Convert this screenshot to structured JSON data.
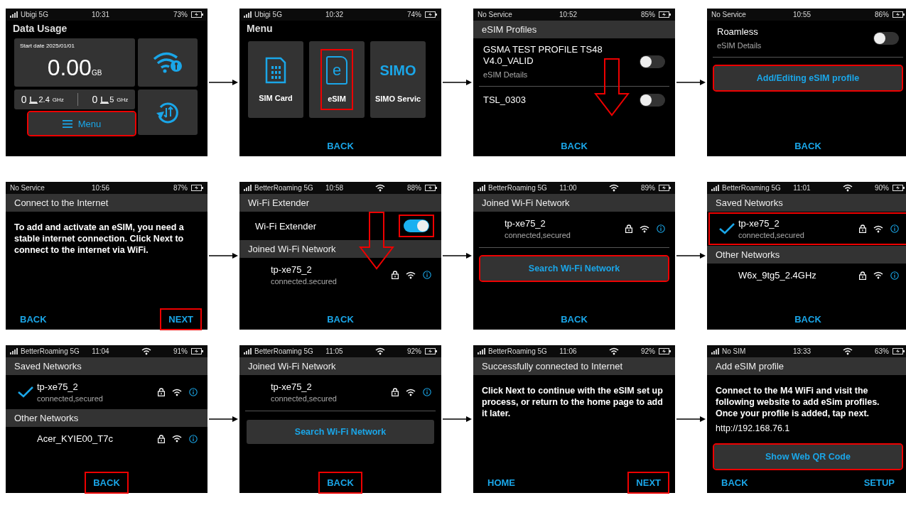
{
  "screens": [
    {
      "status": {
        "signal": true,
        "carrier": "Ubigi 5G",
        "time": "10:31",
        "wifi": false,
        "battery": "73%"
      },
      "scroll_hint": false,
      "blocks": [
        {
          "kind": "title",
          "text": "Data Usage"
        },
        {
          "kind": "dashboard",
          "start_date": "Start date 2025/01/01",
          "value": "0.00",
          "unit": "GB",
          "bands": [
            {
              "count": "0",
              "band": "2.4",
              "unit": "GHz"
            },
            {
              "count": "0",
              "band": "5",
              "unit": "GHz"
            }
          ],
          "menu": {
            "label": "Menu",
            "highlighted": true
          }
        }
      ]
    },
    {
      "status": {
        "signal": true,
        "carrier": "Ubigi 5G",
        "time": "10:32",
        "wifi": false,
        "battery": "74%"
      },
      "scroll_hint": false,
      "blocks": [
        {
          "kind": "title",
          "text": "Menu"
        },
        {
          "kind": "tiles",
          "tiles": [
            {
              "kind": "sim",
              "label": "SIM Card",
              "highlighted": false
            },
            {
              "kind": "esim",
              "glyph": "e",
              "label": "eSIM",
              "highlighted": true
            },
            {
              "kind": "logo",
              "glyph": "SIMO",
              "label": "SIMO Servic",
              "highlighted": false
            }
          ]
        }
      ],
      "footer": [
        {
          "label": "BACK",
          "highlighted": false
        }
      ]
    },
    {
      "status": {
        "signal": false,
        "carrier": "No Service",
        "time": "10:52",
        "wifi": false,
        "battery": "85%"
      },
      "scroll_hint": true,
      "blocks": [
        {
          "kind": "header",
          "text": "eSIM Profiles"
        },
        {
          "kind": "profile",
          "name": "GSMA TEST PROFILE TS48 V4.0_VALID",
          "detail": "eSIM Details",
          "on": false
        },
        {
          "kind": "divider"
        },
        {
          "kind": "profile",
          "name": "TSL_0303",
          "on": false
        }
      ],
      "footer": [
        {
          "label": "BACK",
          "highlighted": false
        }
      ]
    },
    {
      "status": {
        "signal": false,
        "carrier": "No Service",
        "time": "10:55",
        "wifi": false,
        "battery": "86%"
      },
      "scroll_hint": false,
      "blocks": [
        {
          "kind": "profile",
          "name": "Roamless",
          "detail": "eSIM Details",
          "on": false
        },
        {
          "kind": "divider"
        },
        {
          "kind": "button",
          "label": "Add/Editing eSIM profile",
          "highlighted": true
        }
      ],
      "footer": [
        {
          "label": "BACK",
          "highlighted": false
        }
      ]
    },
    {
      "status": {
        "signal": false,
        "carrier": "No Service",
        "time": "10:56",
        "wifi": false,
        "battery": "87%"
      },
      "scroll_hint": false,
      "blocks": [
        {
          "kind": "header",
          "text": "Connect to the Internet"
        },
        {
          "kind": "paragraph",
          "text": "To add and activate an eSIM, you need a stable internet connection. Click Next to connect to the internet via WiFi."
        }
      ],
      "footer": [
        {
          "label": "BACK",
          "highlighted": false
        },
        {
          "label": "NEXT",
          "highlighted": true
        }
      ]
    },
    {
      "status": {
        "signal": true,
        "carrier": "BetterRoaming 5G",
        "time": "10:58",
        "wifi": true,
        "battery": "88%"
      },
      "scroll_hint": true,
      "blocks": [
        {
          "kind": "header",
          "text": "Wi-Fi Extender"
        },
        {
          "kind": "toggle_row",
          "label": "Wi-Fi Extender",
          "on": true,
          "highlighted": true
        },
        {
          "kind": "header",
          "text": "Joined Wi-Fi Network"
        },
        {
          "kind": "network",
          "name": "tp-xe75_2",
          "state": "connected.secured",
          "checked": false,
          "highlighted": false
        }
      ],
      "footer": [
        {
          "label": "BACK",
          "highlighted": false
        }
      ]
    },
    {
      "status": {
        "signal": true,
        "carrier": "BetterRoaming 5G",
        "time": "11:00",
        "wifi": true,
        "battery": "89%"
      },
      "scroll_hint": false,
      "blocks": [
        {
          "kind": "header",
          "text": "Joined Wi-Fi Network"
        },
        {
          "kind": "network",
          "name": "tp-xe75_2",
          "state": "connected,secured",
          "checked": false,
          "highlighted": false
        },
        {
          "kind": "divider"
        },
        {
          "kind": "button",
          "label": "Search Wi-Fi Network",
          "highlighted": true
        }
      ],
      "footer": [
        {
          "label": "BACK",
          "highlighted": false
        }
      ]
    },
    {
      "status": {
        "signal": true,
        "carrier": "BetterRoaming 5G",
        "time": "11:01",
        "wifi": true,
        "battery": "90%"
      },
      "scroll_hint": false,
      "blocks": [
        {
          "kind": "header",
          "text": "Saved Networks"
        },
        {
          "kind": "network",
          "name": "tp-xe75_2",
          "state": "connected,secured",
          "checked": true,
          "highlighted": true
        },
        {
          "kind": "header",
          "text": "Other Networks"
        },
        {
          "kind": "network",
          "name": "W6x_9tg5_2.4GHz",
          "checked": false,
          "highlighted": false
        }
      ],
      "footer": [
        {
          "label": "BACK",
          "highlighted": false
        }
      ]
    },
    {
      "status": {
        "signal": true,
        "carrier": "BetterRoaming 5G",
        "time": "11:04",
        "wifi": true,
        "battery": "91%"
      },
      "scroll_hint": false,
      "blocks": [
        {
          "kind": "header",
          "text": "Saved Networks"
        },
        {
          "kind": "network",
          "name": "tp-xe75_2",
          "state": "connected,secured",
          "checked": true,
          "highlighted": false
        },
        {
          "kind": "header",
          "text": "Other Networks"
        },
        {
          "kind": "network",
          "name": "Acer_KYIE00_T7c",
          "checked": false,
          "highlighted": false
        }
      ],
      "footer": [
        {
          "label": "BACK",
          "highlighted": true
        }
      ]
    },
    {
      "status": {
        "signal": true,
        "carrier": "BetterRoaming 5G",
        "time": "11:05",
        "wifi": true,
        "battery": "92%"
      },
      "scroll_hint": false,
      "blocks": [
        {
          "kind": "header",
          "text": "Joined Wi-Fi Network"
        },
        {
          "kind": "network",
          "name": "tp-xe75_2",
          "state": "connected,secured",
          "checked": false,
          "highlighted": false
        },
        {
          "kind": "divider"
        },
        {
          "kind": "button",
          "label": "Search Wi-Fi Network",
          "highlighted": false
        }
      ],
      "footer": [
        {
          "label": "BACK",
          "highlighted": true
        }
      ]
    },
    {
      "status": {
        "signal": true,
        "carrier": "BetterRoaming 5G",
        "time": "11:06",
        "wifi": true,
        "battery": "92%"
      },
      "scroll_hint": false,
      "blocks": [
        {
          "kind": "header",
          "text": "Successfully connected to Internet"
        },
        {
          "kind": "paragraph",
          "text": "Click Next to continue with the eSIM set up process, or return to the home page to add it later."
        }
      ],
      "footer": [
        {
          "label": "HOME",
          "highlighted": false
        },
        {
          "label": "NEXT",
          "highlighted": true
        }
      ]
    },
    {
      "status": {
        "signal": true,
        "carrier": "No SIM",
        "time": "13:33",
        "wifi": true,
        "battery": "63%"
      },
      "scroll_hint": false,
      "blocks": [
        {
          "kind": "header",
          "text": "Add eSIM profile"
        },
        {
          "kind": "paragraph",
          "text": "Connect to the M4 WiFi and visit the following website to add eSim profiles. Once your profile is added, tap next."
        },
        {
          "kind": "url",
          "text": "http://192.168.76.1"
        },
        {
          "kind": "button",
          "label": "Show Web QR Code",
          "highlighted": true
        }
      ],
      "footer": [
        {
          "label": "BACK",
          "highlighted": false
        },
        {
          "label": "SETUP",
          "highlighted": false
        }
      ]
    }
  ]
}
